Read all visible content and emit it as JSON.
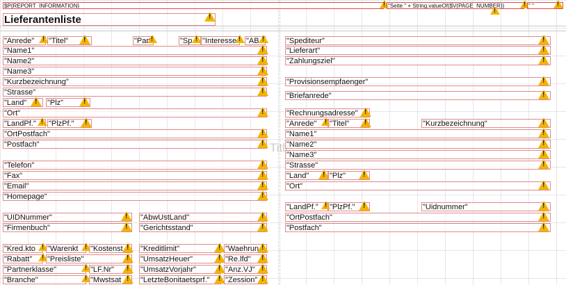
{
  "header": {
    "report_information": "$P{REPORT_INFORMATION}",
    "page_number_expr": "\"Seite \" + String.valueOf($V{PAGE_NUMBER})",
    "page_count_expr": "\" \""
  },
  "title": "Lieferantenliste",
  "watermark": "Title",
  "left_fields": {
    "anrede": "\"Anrede\"",
    "titel": "\"Titel\"",
    "partnera": "\"Partnera",
    "sp": "\"Sp",
    "interesse": "\"Interesse",
    "ab": "\"AB",
    "name1": "\"Name1\"",
    "name2": "\"Name2\"",
    "name3": "\"Name3\"",
    "kurzbezeichnung": "\"Kurzbezeichnung\"",
    "strasse": "\"Strasse\"",
    "land": "\"Land\"",
    "plz": "\"Plz\"",
    "ort": "\"Ort\"",
    "landpf": "\"LandPf.\"",
    "plzpf": "\"PlzPf.\"",
    "ortpostfach": "\"OrtPostfach\"",
    "postfach": "\"Postfach\"",
    "telefon": "\"Telefon\"",
    "fax": "\"Fax\"",
    "email": "\"Email\"",
    "homepage": "\"Homepage\""
  },
  "right_fields": {
    "spediteur": "\"Spediteur\"",
    "lieferart": "\"Lieferart\"",
    "zahlungsziel": "\"Zahlungsziel\"",
    "provisionsempfaenger": "\"Provisionsempfaenger\"",
    "briefanrede": "\"Briefanrede\"",
    "rechnungsadresse": "\"Rechnungsadresse\"",
    "anrede": "\"Anrede\"",
    "titel": "\"Titel\"",
    "kurzbezeichnung": "\"Kurzbezeichnung\"",
    "name1": "\"Name1\"",
    "name2": "\"Name2\"",
    "name3": "\"Name3\"",
    "strasse": "\"Strasse\"",
    "land": "\"Land\"",
    "plz": "\"Plz\"",
    "ort": "\"Ort\"",
    "landpf": "\"LandPf.\"",
    "plzpf": "\"PlzPf.\"",
    "uidnummer": "\"Uidnummer\"",
    "ortpostfach": "\"OrtPostfach\"",
    "postfach": "\"Postfach\""
  },
  "lower_fields": {
    "uidnummer": "\"UIDNummer\"",
    "abwustland": "\"AbwUstLand\"",
    "firmenbuch": "\"Firmenbuch\"",
    "gerichtsstand": "\"Gerichtsstand\"",
    "kredkto": "\"Kred.kto",
    "warenkt": "\"Warenkt",
    "kostenst": "\"Kostenst",
    "kreditlimit": "\"Kreditlimit\"",
    "waehrung": "\"Waehrun",
    "rabatt": "\"Rabatt\"",
    "preisliste": "\"Preisliste\"",
    "umsatzheuer": "\"UmsatzHeuer\"",
    "relfd": "\"Re.lfd\"",
    "partnerklasse": "\"Partnerklasse\"",
    "lfnr": "\"LF.Nr\"",
    "umsatzvorjahr": "\"UmsatzVorjahr\"",
    "anzvj": "\"Anz.VJ\"",
    "branche": "\"Branche\"",
    "mwstsat": "\"Mwstsat",
    "letztebonitaetsprf": "\"LetzteBonitaetsprf.\"",
    "zession": "\"Zession\""
  }
}
